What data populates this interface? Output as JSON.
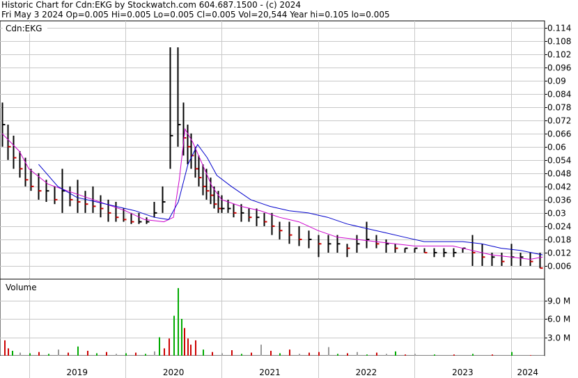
{
  "header": {
    "line1": "Historic Chart for Cdn:EKG by Stockwatch.com 604.687.1500 - (c) 2024",
    "line2": "Fri May  3 2024  Op=0.005  Hi=0.005  Lo=0.005  Cl=0.005  Vol=20,544  Year hi=0.105  lo=0.005"
  },
  "colors": {
    "price_bar": "#000000",
    "down_bar": "#cc0000",
    "ma_short": "#cc00cc",
    "ma_long": "#0000cc",
    "vol_up": "#00aa00",
    "vol_down": "#cc0000",
    "vol_flat": "#999999",
    "grid": "#c8c8c8"
  },
  "chart_data": [
    {
      "type": "line",
      "panel": "price",
      "label": "Cdn:EKG",
      "ylim": [
        0,
        0.117
      ],
      "yticks": [
        "0.114",
        "0.108",
        "0.102",
        "0.096",
        "0.09",
        "0.084",
        "0.078",
        "0.072",
        "0.066",
        "0.06",
        "0.054",
        "0.048",
        "0.042",
        "0.036",
        "0.03",
        "0.024",
        "0.018",
        "0.012",
        "0.006"
      ],
      "ytick_values": [
        0.114,
        0.108,
        0.102,
        0.096,
        0.09,
        0.084,
        0.078,
        0.072,
        0.066,
        0.06,
        0.054,
        0.048,
        0.042,
        0.036,
        0.03,
        0.024,
        0.018,
        0.012,
        0.006
      ],
      "x_labels": [
        "2019",
        "2020",
        "2021",
        "2022",
        "2023",
        "2024"
      ],
      "year_boundaries": [
        2019.0,
        2020.0,
        2021.0,
        2022.0,
        2023.0,
        2024.0
      ],
      "x_range": [
        2018.7,
        2024.35
      ],
      "grid": true,
      "series": [
        {
          "style": "ohlc",
          "x": [
            2018.72,
            2018.78,
            2018.84,
            2018.9,
            2018.96,
            2019.02,
            2019.1,
            2019.18,
            2019.26,
            2019.34,
            2019.42,
            2019.5,
            2019.58,
            2019.66,
            2019.74,
            2019.82,
            2019.9,
            2019.98,
            2020.06,
            2020.14,
            2020.22,
            2020.3,
            2020.38,
            2020.46,
            2020.54,
            2020.6,
            2020.64,
            2020.68,
            2020.72,
            2020.76,
            2020.8,
            2020.84,
            2020.88,
            2020.92,
            2020.96,
            2021.0,
            2021.06,
            2021.12,
            2021.2,
            2021.28,
            2021.36,
            2021.44,
            2021.52,
            2021.6,
            2021.7,
            2021.8,
            2021.9,
            2022.0,
            2022.1,
            2022.2,
            2022.3,
            2022.4,
            2022.5,
            2022.6,
            2022.7,
            2022.8,
            2022.9,
            2023.0,
            2023.1,
            2023.2,
            2023.3,
            2023.4,
            2023.5,
            2023.6,
            2023.7,
            2023.8,
            2023.9,
            2024.0,
            2024.1,
            2024.2,
            2024.3
          ],
          "high": [
            0.08,
            0.07,
            0.065,
            0.058,
            0.055,
            0.05,
            0.048,
            0.045,
            0.042,
            0.05,
            0.042,
            0.045,
            0.04,
            0.042,
            0.038,
            0.036,
            0.035,
            0.032,
            0.03,
            0.03,
            0.028,
            0.035,
            0.042,
            0.105,
            0.105,
            0.08,
            0.07,
            0.066,
            0.06,
            0.056,
            0.052,
            0.05,
            0.046,
            0.042,
            0.04,
            0.038,
            0.036,
            0.034,
            0.034,
            0.032,
            0.032,
            0.03,
            0.03,
            0.026,
            0.026,
            0.024,
            0.022,
            0.02,
            0.02,
            0.02,
            0.016,
            0.02,
            0.026,
            0.02,
            0.018,
            0.016,
            0.014,
            0.014,
            0.014,
            0.014,
            0.014,
            0.014,
            0.014,
            0.02,
            0.016,
            0.012,
            0.012,
            0.016,
            0.012,
            0.012,
            0.012
          ],
          "low": [
            0.06,
            0.054,
            0.05,
            0.046,
            0.042,
            0.04,
            0.036,
            0.035,
            0.034,
            0.03,
            0.033,
            0.03,
            0.03,
            0.03,
            0.028,
            0.026,
            0.026,
            0.026,
            0.025,
            0.025,
            0.025,
            0.028,
            0.03,
            0.05,
            0.06,
            0.056,
            0.052,
            0.05,
            0.046,
            0.042,
            0.038,
            0.036,
            0.034,
            0.032,
            0.03,
            0.03,
            0.03,
            0.028,
            0.026,
            0.026,
            0.024,
            0.024,
            0.02,
            0.018,
            0.016,
            0.015,
            0.014,
            0.01,
            0.012,
            0.012,
            0.01,
            0.012,
            0.014,
            0.014,
            0.012,
            0.012,
            0.012,
            0.012,
            0.012,
            0.01,
            0.01,
            0.01,
            0.012,
            0.006,
            0.006,
            0.006,
            0.006,
            0.006,
            0.006,
            0.006,
            0.005
          ],
          "close": [
            0.07,
            0.06,
            0.055,
            0.05,
            0.045,
            0.042,
            0.04,
            0.04,
            0.036,
            0.04,
            0.036,
            0.035,
            0.034,
            0.033,
            0.032,
            0.03,
            0.028,
            0.027,
            0.026,
            0.026,
            0.026,
            0.03,
            0.035,
            0.065,
            0.07,
            0.064,
            0.06,
            0.056,
            0.05,
            0.046,
            0.042,
            0.04,
            0.038,
            0.034,
            0.032,
            0.032,
            0.032,
            0.03,
            0.03,
            0.028,
            0.028,
            0.026,
            0.024,
            0.022,
            0.02,
            0.018,
            0.018,
            0.016,
            0.016,
            0.016,
            0.014,
            0.016,
            0.018,
            0.016,
            0.016,
            0.014,
            0.014,
            0.014,
            0.012,
            0.012,
            0.012,
            0.012,
            0.014,
            0.012,
            0.01,
            0.01,
            0.008,
            0.01,
            0.01,
            0.008,
            0.005
          ]
        },
        {
          "name": "",
          "style": "ma_short",
          "x": [
            2018.72,
            2018.9,
            2019.0,
            2019.2,
            2019.4,
            2019.6,
            2019.8,
            2020.0,
            2020.2,
            2020.4,
            2020.5,
            2020.56,
            2020.62,
            2020.7,
            2020.8,
            2020.9,
            2021.0,
            2021.2,
            2021.4,
            2021.6,
            2021.8,
            2022.0,
            2022.2,
            2022.4,
            2022.6,
            2022.8,
            2023.0,
            2023.2,
            2023.4,
            2023.6,
            2023.8,
            2024.0,
            2024.2,
            2024.33
          ],
          "y": [
            0.066,
            0.058,
            0.05,
            0.043,
            0.04,
            0.037,
            0.034,
            0.031,
            0.027,
            0.026,
            0.028,
            0.045,
            0.068,
            0.062,
            0.052,
            0.042,
            0.036,
            0.033,
            0.031,
            0.028,
            0.026,
            0.022,
            0.019,
            0.018,
            0.017,
            0.016,
            0.015,
            0.015,
            0.015,
            0.013,
            0.011,
            0.01,
            0.009,
            0.01
          ]
        },
        {
          "name": "",
          "style": "ma_long",
          "x": [
            2019.1,
            2019.3,
            2019.5,
            2019.7,
            2019.9,
            2020.1,
            2020.3,
            2020.45,
            2020.55,
            2020.65,
            2020.75,
            2020.85,
            2020.95,
            2021.1,
            2021.3,
            2021.5,
            2021.7,
            2021.9,
            2022.1,
            2022.3,
            2022.5,
            2022.7,
            2022.9,
            2023.1,
            2023.3,
            2023.5,
            2023.7,
            2023.9,
            2024.1,
            2024.33
          ],
          "y": [
            0.052,
            0.042,
            0.037,
            0.035,
            0.033,
            0.031,
            0.028,
            0.027,
            0.035,
            0.052,
            0.061,
            0.055,
            0.047,
            0.042,
            0.036,
            0.033,
            0.031,
            0.03,
            0.028,
            0.025,
            0.023,
            0.021,
            0.019,
            0.017,
            0.017,
            0.017,
            0.016,
            0.014,
            0.013,
            0.011
          ]
        }
      ]
    },
    {
      "type": "bar",
      "panel": "volume",
      "label": "Volume",
      "ylim": [
        0,
        12000000
      ],
      "yticks": [
        "9.0 M",
        "6.0 M",
        "3.0 M"
      ],
      "ytick_values": [
        9000000,
        6000000,
        3000000
      ],
      "grid": true,
      "x": [
        2018.74,
        2018.78,
        2018.82,
        2018.9,
        2019.0,
        2019.1,
        2019.2,
        2019.3,
        2019.4,
        2019.5,
        2019.6,
        2019.7,
        2019.8,
        2019.9,
        2020.0,
        2020.1,
        2020.2,
        2020.3,
        2020.35,
        2020.4,
        2020.45,
        2020.5,
        2020.54,
        2020.58,
        2020.61,
        2020.64,
        2020.67,
        2020.72,
        2020.8,
        2020.9,
        2021.0,
        2021.1,
        2021.2,
        2021.3,
        2021.4,
        2021.5,
        2021.6,
        2021.7,
        2021.8,
        2021.9,
        2022.0,
        2022.1,
        2022.2,
        2022.3,
        2022.4,
        2022.5,
        2022.6,
        2022.7,
        2022.8,
        2022.9,
        2023.0,
        2023.2,
        2023.4,
        2023.6,
        2023.8,
        2024.0,
        2024.2
      ],
      "values": [
        2500000,
        1200000,
        800000,
        500000,
        400000,
        600000,
        300000,
        1000000,
        500000,
        1500000,
        800000,
        400000,
        600000,
        300000,
        400000,
        500000,
        300000,
        700000,
        3000000,
        1200000,
        2800000,
        6500000,
        11000000,
        6000000,
        4500000,
        2800000,
        1800000,
        2500000,
        1000000,
        600000,
        400000,
        900000,
        300000,
        500000,
        1800000,
        800000,
        400000,
        1000000,
        300000,
        500000,
        600000,
        1400000,
        300000,
        400000,
        600000,
        200000,
        500000,
        300000,
        700000,
        200000,
        300000,
        200000,
        200000,
        300000,
        200000,
        600000,
        100000
      ],
      "dir": [
        "down",
        "down",
        "up",
        "flat",
        "up",
        "down",
        "up",
        "flat",
        "down",
        "up",
        "down",
        "up",
        "down",
        "flat",
        "up",
        "down",
        "up",
        "flat",
        "up",
        "down",
        "down",
        "up",
        "up",
        "up",
        "down",
        "down",
        "down",
        "down",
        "up",
        "down",
        "flat",
        "down",
        "up",
        "down",
        "flat",
        "down",
        "up",
        "down",
        "flat",
        "down",
        "down",
        "flat",
        "up",
        "down",
        "flat",
        "up",
        "down",
        "flat",
        "up",
        "down",
        "flat",
        "up",
        "down",
        "up",
        "down",
        "up",
        "down"
      ]
    }
  ]
}
